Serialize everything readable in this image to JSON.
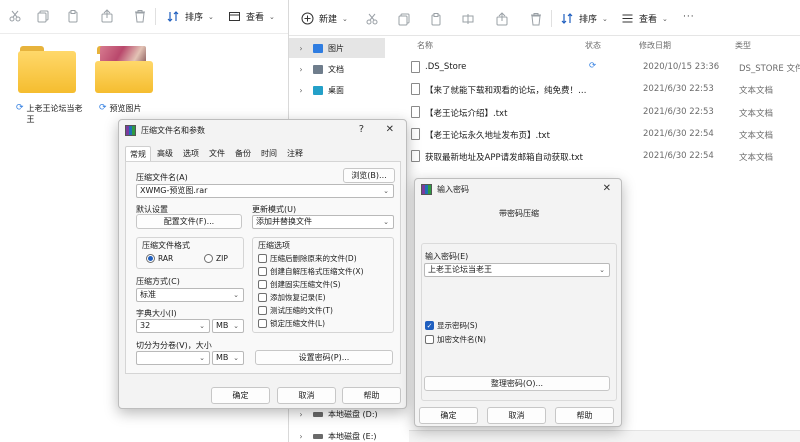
{
  "left_window": {
    "toolbar": {
      "sort_label": "排序",
      "view_label": "查看"
    },
    "items": [
      {
        "name": "上老王论坛当老王",
        "sync": "⟳"
      },
      {
        "name": "预览图片",
        "sync": "⟳"
      }
    ]
  },
  "right_window": {
    "toolbar": {
      "new_label": "新建",
      "sort_label": "排序",
      "view_label": "查看",
      "more_label": "···"
    },
    "nav": [
      {
        "label": "图片",
        "selected": true
      },
      {
        "label": "文档",
        "selected": false
      },
      {
        "label": "桌面",
        "selected": false
      }
    ],
    "drives": [
      {
        "label": "本地磁盘 (D:)"
      },
      {
        "label": "本地磁盘 (E:)"
      }
    ],
    "columns": {
      "name": "名称",
      "status": "状态",
      "date": "修改日期",
      "type": "类型"
    },
    "files": [
      {
        "name": ".DS_Store",
        "status": "⟳",
        "date": "2020/10/15 23:36",
        "type": "DS_STORE 文件"
      },
      {
        "name": "【来了就能下载和观看的论坛，纯免费！…",
        "status": "",
        "date": "2021/6/30 22:53",
        "type": "文本文档"
      },
      {
        "name": "【老王论坛介绍】.txt",
        "status": "",
        "date": "2021/6/30 22:53",
        "type": "文本文档"
      },
      {
        "name": "【老王论坛永久地址发布页】.txt",
        "status": "",
        "date": "2021/6/30 22:54",
        "type": "文本文档"
      },
      {
        "name": "获取最新地址及APP请发邮箱自动获取.txt",
        "status": "",
        "date": "2021/6/30 22:54",
        "type": "文本文档"
      }
    ]
  },
  "archive_dialog": {
    "title": "压缩文件名和参数",
    "help_glyph": "?",
    "close_glyph": "✕",
    "tabs": [
      "常规",
      "高级",
      "选项",
      "文件",
      "备份",
      "时间",
      "注释"
    ],
    "archive_name_label": "压缩文件名(A)",
    "browse_label": "浏览(B)...",
    "archive_name_value": "XWMG-预览图.rar",
    "default_settings_label": "默认设置",
    "profiles_label": "配置文件(F)...",
    "update_mode_label": "更新模式(U)",
    "update_mode_value": "添加并替换文件",
    "format_label": "压缩文件格式",
    "format_rar": "RAR",
    "format_zip": "ZIP",
    "options_label": "压缩选项",
    "options": [
      {
        "label": "压缩后删除原来的文件(D)",
        "checked": false
      },
      {
        "label": "创建自解压格式压缩文件(X)",
        "checked": false
      },
      {
        "label": "创建固实压缩文件(S)",
        "checked": false
      },
      {
        "label": "添加恢复记录(E)",
        "checked": false
      },
      {
        "label": "测试压缩的文件(T)",
        "checked": false
      },
      {
        "label": "锁定压缩文件(L)",
        "checked": false
      }
    ],
    "method_label": "压缩方式(C)",
    "method_value": "标准",
    "dict_label": "字典大小(I)",
    "dict_value": "32",
    "dict_unit": "MB",
    "split_label": "切分为分卷(V)，大小",
    "split_value": "",
    "split_unit": "MB",
    "set_password_label": "设置密码(P)...",
    "ok_label": "确定",
    "cancel_label": "取消",
    "help_label": "帮助"
  },
  "password_dialog": {
    "title": "输入密码",
    "close_glyph": "✕",
    "heading": "带密码压缩",
    "enter_label": "输入密码(E)",
    "password_value": "上老王论坛当老王",
    "show_password_label": "显示密码(S)",
    "show_password_checked": true,
    "encrypt_names_label": "加密文件名(N)",
    "encrypt_names_checked": false,
    "organize_label": "整理密码(O)...",
    "ok_label": "确定",
    "cancel_label": "取消",
    "help_label": "帮助"
  }
}
